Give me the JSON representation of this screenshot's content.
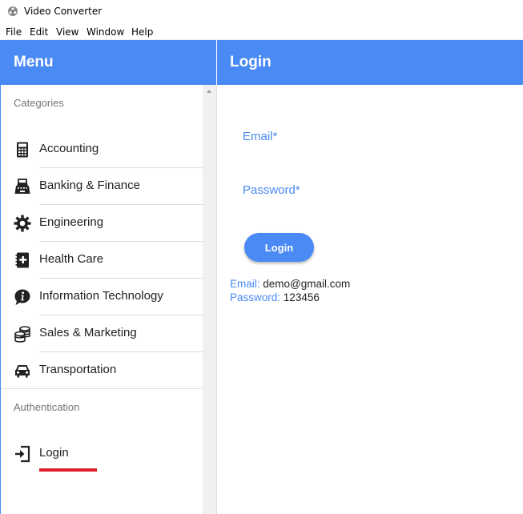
{
  "window": {
    "title": "Video Converter"
  },
  "menubar": {
    "items": [
      "File",
      "Edit",
      "View",
      "Window",
      "Help"
    ]
  },
  "sidebar": {
    "header": "Menu",
    "sections": [
      {
        "label": "Categories",
        "items": [
          {
            "label": "Accounting",
            "icon": "calculator-icon"
          },
          {
            "label": "Banking & Finance",
            "icon": "cash-register-icon"
          },
          {
            "label": "Engineering",
            "icon": "gear-icon"
          },
          {
            "label": "Health Care",
            "icon": "medical-book-icon"
          },
          {
            "label": "Information Technology",
            "icon": "info-bubble-icon"
          },
          {
            "label": "Sales & Marketing",
            "icon": "coins-icon"
          },
          {
            "label": "Transportation",
            "icon": "car-icon"
          }
        ]
      },
      {
        "label": "Authentication",
        "items": [
          {
            "label": "Login",
            "icon": "sign-in-icon",
            "selected": true
          }
        ]
      }
    ]
  },
  "main": {
    "header": "Login",
    "form": {
      "email_label": "Email*",
      "password_label": "Password*",
      "submit_label": "Login"
    },
    "credentials": {
      "email_key": "Email:",
      "email_value": "demo@gmail.com",
      "password_key": "Password:",
      "password_value": "123456"
    }
  },
  "colors": {
    "accent": "#4a8af4",
    "selected_underline": "#e01e2b",
    "text": "#212121",
    "muted": "#757575"
  }
}
